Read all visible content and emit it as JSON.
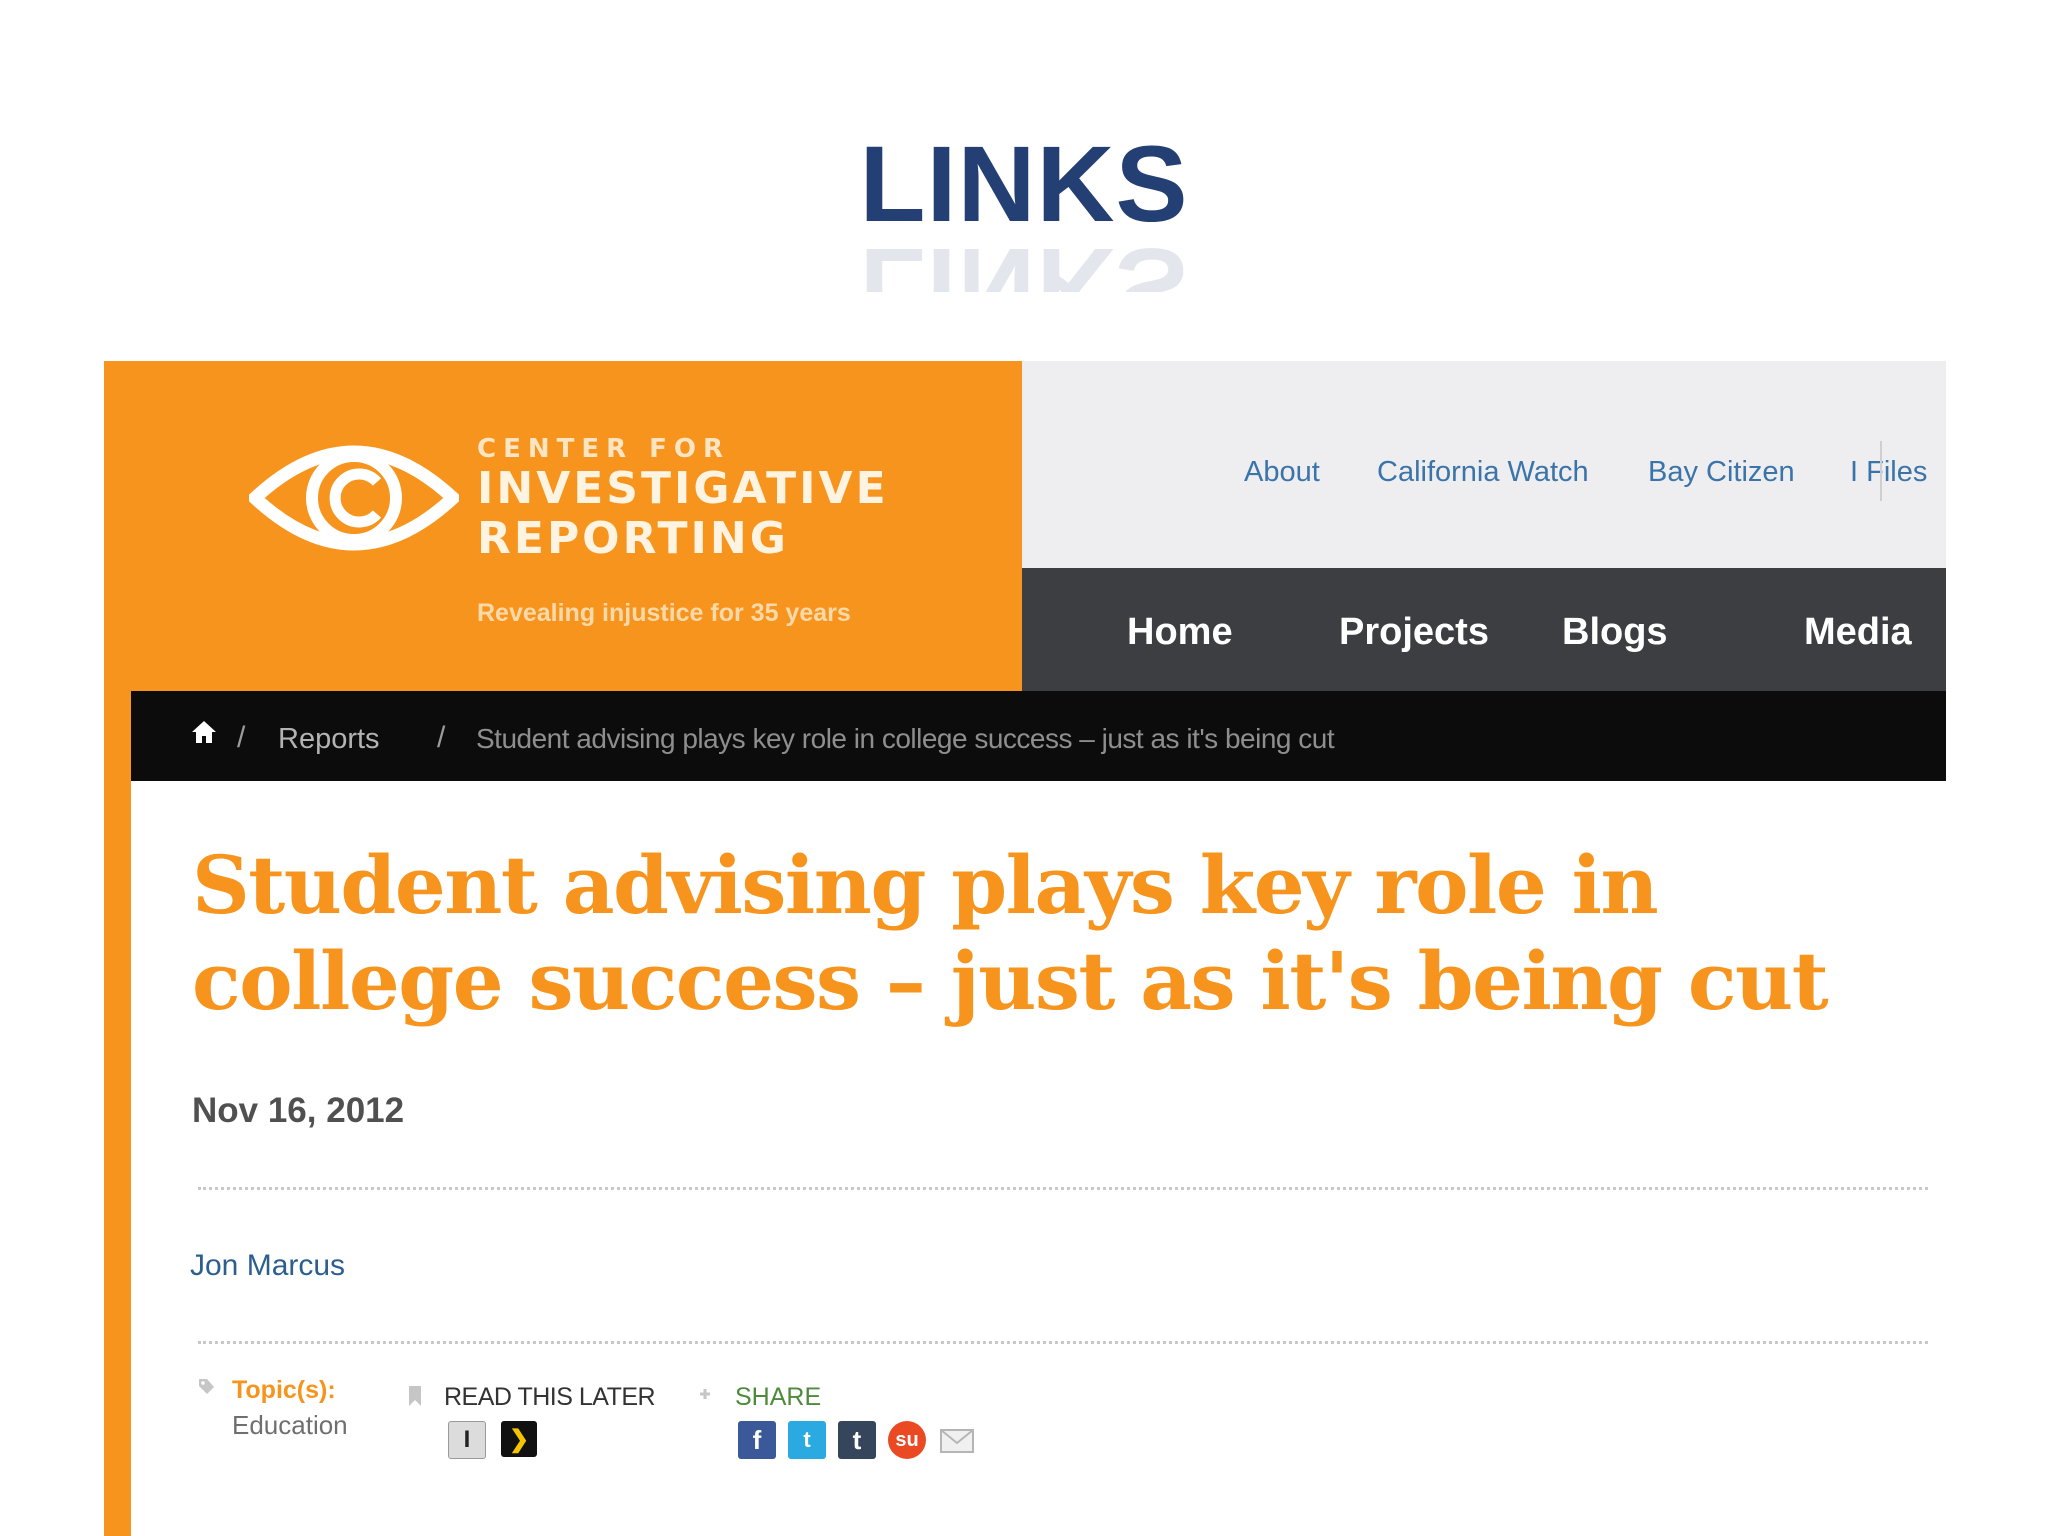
{
  "slide": {
    "title": "LINKS"
  },
  "site": {
    "logo": {
      "line1": "CENTER FOR",
      "line2": "INVESTIGATIVE",
      "line3": "REPORTING"
    },
    "tagline": "Revealing injustice for 35 years",
    "top_links": [
      "About",
      "California Watch",
      "Bay Citizen",
      "I Files"
    ],
    "nav": [
      "Home",
      "Projects",
      "Blogs",
      "Media"
    ],
    "brand_color": "#f7941d"
  },
  "breadcrumb": {
    "items": [
      "Reports",
      "Student advising plays key role in college success – just as it's being cut"
    ],
    "separator": "/"
  },
  "article": {
    "title": "Student advising plays key role in college success – just as it's being cut",
    "date": "Nov 16, 2012",
    "author": "Jon Marcus",
    "topics_label": "Topic(s):",
    "topics_value": "Education",
    "read_later_label": "READ THIS LATER",
    "share_label": "SHARE"
  },
  "share_icons": [
    "facebook-icon",
    "twitter-icon",
    "tumblr-icon",
    "stumbleupon-icon",
    "email-icon"
  ],
  "read_later_icons": [
    "instapaper-icon",
    "readability-icon"
  ]
}
